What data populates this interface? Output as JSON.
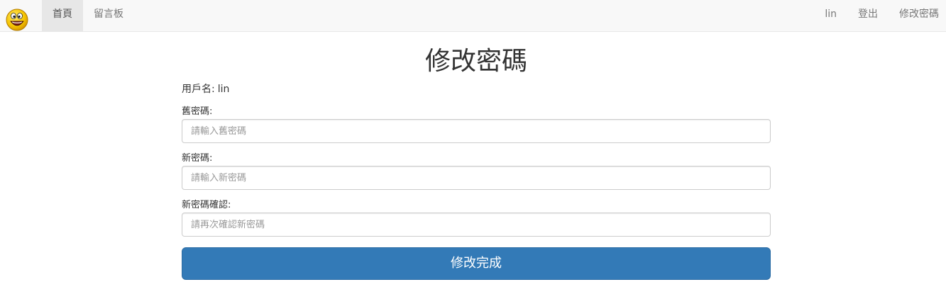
{
  "nav": {
    "brand_icon": "smiley-face-icon",
    "left_items": [
      {
        "label": "首頁",
        "active": true
      },
      {
        "label": "留言板",
        "active": false
      }
    ],
    "right_items": [
      {
        "label": "lin"
      },
      {
        "label": "登出"
      },
      {
        "label": "修改密碼"
      }
    ]
  },
  "page": {
    "title": "修改密碼",
    "username_label": "用戶名:",
    "username_value": "lin"
  },
  "form": {
    "old_password": {
      "label": "舊密碼:",
      "placeholder": "請輸入舊密碼",
      "value": ""
    },
    "new_password": {
      "label": "新密碼:",
      "placeholder": "請輸入新密碼",
      "value": ""
    },
    "confirm_password": {
      "label": "新密碼確認:",
      "placeholder": "請再次確認新密碼",
      "value": ""
    },
    "submit_label": "修改完成"
  },
  "colors": {
    "primary": "#337ab7",
    "navbar_bg": "#f8f8f8",
    "nav_active_bg": "#e7e7e7"
  }
}
